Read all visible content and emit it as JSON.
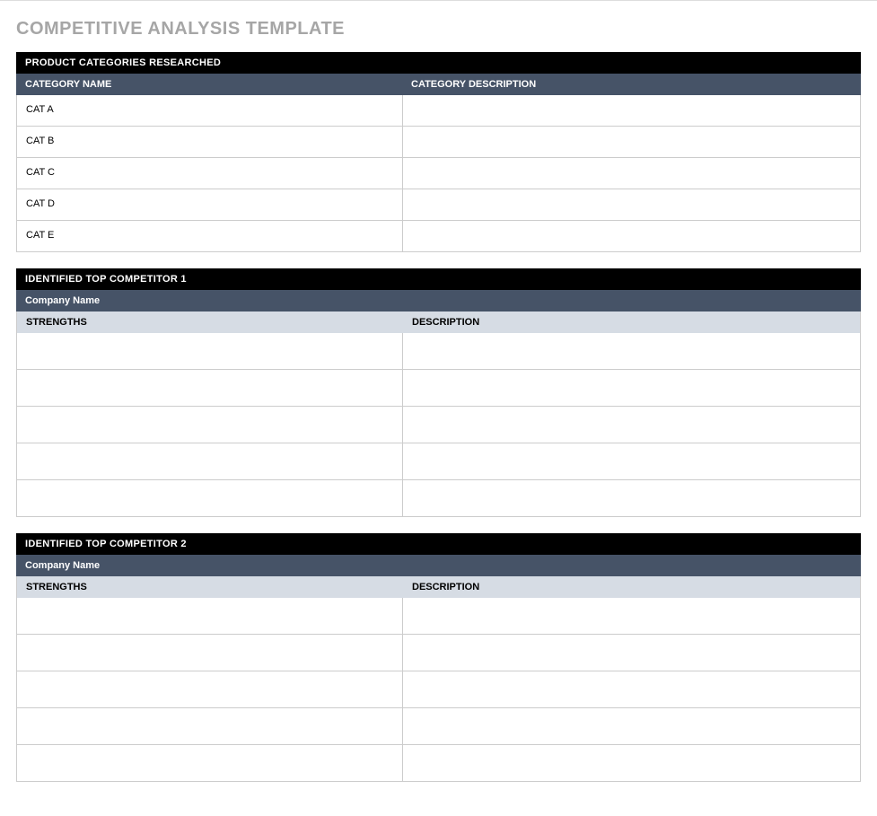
{
  "title": "COMPETITIVE ANALYSIS TEMPLATE",
  "categories_section": {
    "header": "PRODUCT CATEGORIES RESEARCHED",
    "col_name": "CATEGORY NAME",
    "col_desc": "CATEGORY DESCRIPTION",
    "rows": [
      {
        "name": "CAT A",
        "desc": ""
      },
      {
        "name": "CAT B",
        "desc": ""
      },
      {
        "name": "CAT C",
        "desc": ""
      },
      {
        "name": "CAT D",
        "desc": ""
      },
      {
        "name": "CAT E",
        "desc": ""
      }
    ]
  },
  "competitor1": {
    "header": "IDENTIFIED TOP COMPETITOR 1",
    "company_label": "Company Name",
    "col_strengths": "STRENGTHS",
    "col_desc": "DESCRIPTION",
    "rows": [
      {
        "strength": "",
        "desc": ""
      },
      {
        "strength": "",
        "desc": ""
      },
      {
        "strength": "",
        "desc": ""
      },
      {
        "strength": "",
        "desc": ""
      },
      {
        "strength": "",
        "desc": ""
      }
    ]
  },
  "competitor2": {
    "header": "IDENTIFIED TOP COMPETITOR 2",
    "company_label": "Company Name",
    "col_strengths": "STRENGTHS",
    "col_desc": "DESCRIPTION",
    "rows": [
      {
        "strength": "",
        "desc": ""
      },
      {
        "strength": "",
        "desc": ""
      },
      {
        "strength": "",
        "desc": ""
      },
      {
        "strength": "",
        "desc": ""
      },
      {
        "strength": "",
        "desc": ""
      }
    ]
  }
}
